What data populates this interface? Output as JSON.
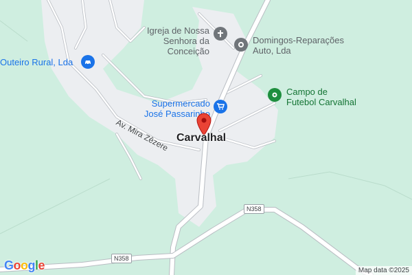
{
  "map": {
    "town_label": "Carvalhal",
    "street_label": "Av. Mira Zêzere",
    "road_shields": [
      "N358",
      "N358"
    ],
    "pois": {
      "church": {
        "name": "Igreja de Nossa\nSenhora da Conceição",
        "icon": "cross-icon",
        "color": "#70757a"
      },
      "repairs": {
        "name": "Domingos-Reparações\nAuto, Lda",
        "icon": "wrench-icon",
        "color": "#70757a"
      },
      "outeiro": {
        "name": "Outeiro Rural, Lda",
        "icon": "car-icon",
        "color": "#1a73e8"
      },
      "supermarket": {
        "name": "Supermercado\nJosé Passarinho",
        "icon": "cart-icon",
        "color": "#1a73e8"
      },
      "football": {
        "name": "Campo de\nFutebol Carvalhal",
        "icon": "pitch-icon",
        "color": "#1e8e3e"
      }
    },
    "pin_color": "#ea4335",
    "colors": {
      "land": "#cfeee0",
      "urban": "#eceef1",
      "road": "#ffffff",
      "road_outline": "#b8bcc2"
    }
  },
  "footer": {
    "logo": "Google",
    "attribution": "Map data ©2025"
  }
}
